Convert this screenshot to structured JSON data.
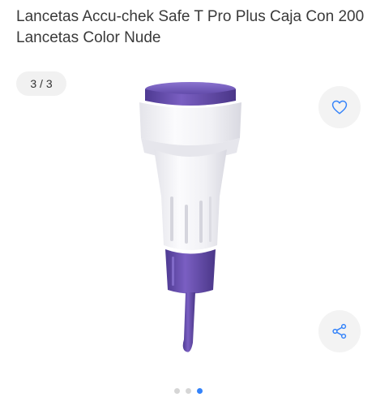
{
  "product": {
    "title": "Lancetas Accu-chek Safe T Pro Plus Caja Con 200 Lancetas Color Nude"
  },
  "gallery": {
    "counter": "3 / 3",
    "total_images": 3,
    "current_image": 3
  },
  "actions": {
    "favorite_icon": "heart-icon",
    "share_icon": "share-icon"
  },
  "colors": {
    "accent": "#3483fa",
    "icon_blue": "#3483fa",
    "lancet_purple": "#6a4fb0",
    "lancet_white": "#f4f4f6"
  }
}
